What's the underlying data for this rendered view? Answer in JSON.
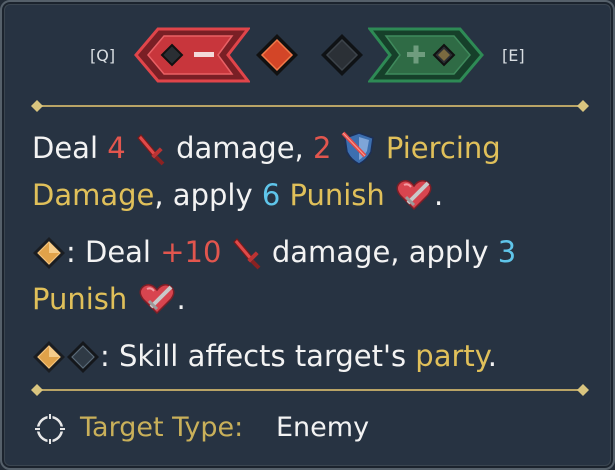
{
  "header": {
    "prev_hotkey": "[Q]",
    "next_hotkey": "[E]",
    "prev_button_icon": "minus-icon",
    "next_button_icon": "plus-icon"
  },
  "description": {
    "line1": {
      "deal": "Deal ",
      "damage_value": "4",
      "damage_text": " damage, ",
      "piercing_value": "2",
      "piercing_label": " Piercing"
    },
    "line2": {
      "damage_word": "Damage",
      "apply_text": ", apply ",
      "punish_value": "6",
      "punish_label": " Punish",
      "period": "."
    },
    "line3": {
      "prefix": ": Deal ",
      "bonus_value": "+10",
      "damage_text": " damage, apply ",
      "punish_value": "3"
    },
    "line4": {
      "punish_label": "Punish",
      "period": "."
    },
    "line5": {
      "prefix": ": Skill affects target's ",
      "party_word": "party",
      "period": "."
    }
  },
  "footer": {
    "target_type_label": "Target Type:",
    "target_type_value": "Enemy"
  },
  "colors": {
    "panel_bg": "#273342",
    "damage_red": "#e2564e",
    "status_blue": "#5fc5ea",
    "keyword_gold": "#e0c05a",
    "minus_button": "#c83a3a",
    "plus_button": "#2f6b45"
  }
}
